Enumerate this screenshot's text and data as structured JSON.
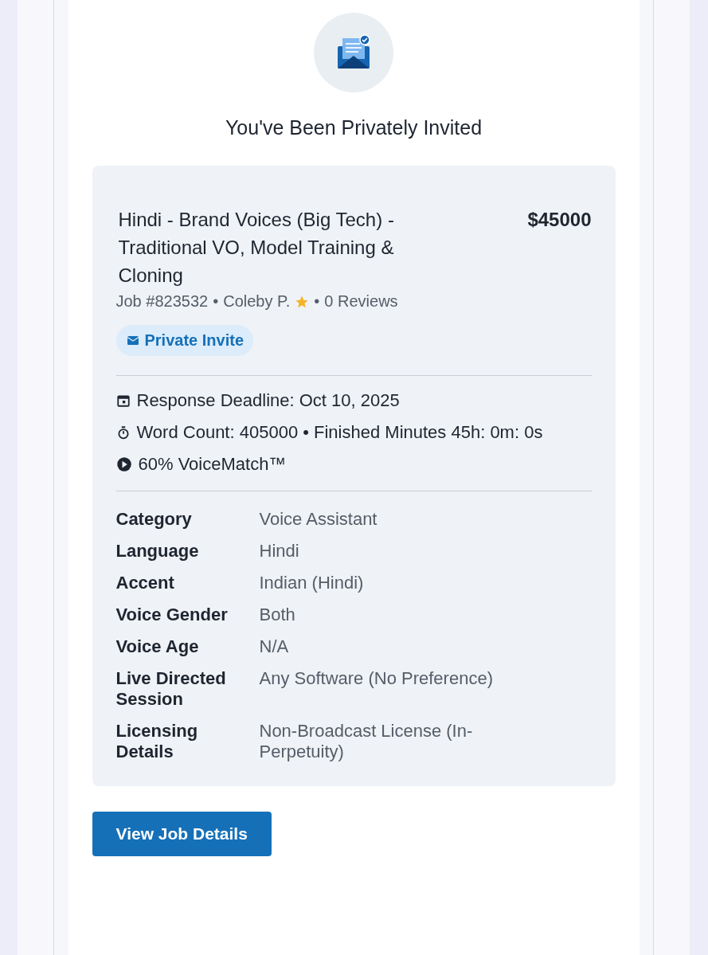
{
  "heading": "You've Been Privately Invited",
  "job": {
    "title": "Hindi - Brand Voices (Big Tech) - Traditional VO, Model Training & Cloning",
    "budget": "$45000",
    "job_number": "Job #823532",
    "client": "Coleby P.",
    "separator": "•",
    "reviews": "0 Reviews",
    "badge": "Private Invite"
  },
  "facts": [
    {
      "kind": "deadline",
      "text": "Response Deadline: Oct 10, 2025"
    },
    {
      "kind": "duration",
      "text": "Word Count: 405000 • Finished Minutes 45h: 0m: 0s"
    },
    {
      "kind": "match",
      "text": "60% VoiceMatch™"
    }
  ],
  "details": [
    {
      "label": "Category",
      "value": "Voice Assistant"
    },
    {
      "label": "Language",
      "value": "Hindi"
    },
    {
      "label": "Accent",
      "value": "Indian (Hindi)"
    },
    {
      "label": "Voice Gender",
      "value": "Both"
    },
    {
      "label": "Voice Age",
      "value": "N/A"
    },
    {
      "label": "Live Directed Session",
      "value": "Any Software (No Preference)"
    },
    {
      "label": "Licensing Details",
      "value": "Non-Broadcast License (In-Perpetuity)"
    }
  ],
  "button": "View Job Details"
}
